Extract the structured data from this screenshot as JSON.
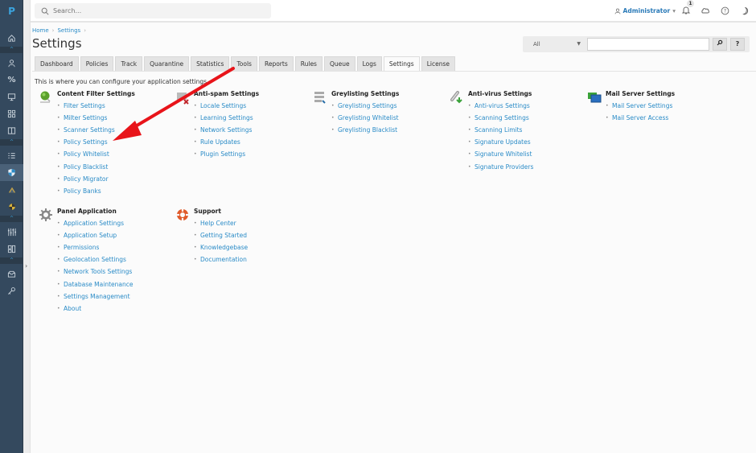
{
  "app": {
    "logo_letter": "P"
  },
  "topbar": {
    "search_placeholder": "Search...",
    "user_label": "Administrator",
    "notification_count": "1"
  },
  "breadcrumb": [
    {
      "label": "Home"
    },
    {
      "label": "Settings"
    }
  ],
  "page": {
    "title": "Settings",
    "intro": "This is where you can configure your application settings."
  },
  "filter": {
    "select_value": "All",
    "input_value": "",
    "search_button": "⌕",
    "help_button": "?"
  },
  "tabs": [
    {
      "label": "Dashboard",
      "active": false
    },
    {
      "label": "Policies",
      "active": false
    },
    {
      "label": "Track",
      "active": false
    },
    {
      "label": "Quarantine",
      "active": false
    },
    {
      "label": "Statistics",
      "active": false
    },
    {
      "label": "Tools",
      "active": false
    },
    {
      "label": "Reports",
      "active": false
    },
    {
      "label": "Rules",
      "active": false
    },
    {
      "label": "Queue",
      "active": false
    },
    {
      "label": "Logs",
      "active": false
    },
    {
      "label": "Settings",
      "active": true
    },
    {
      "label": "License",
      "active": false
    }
  ],
  "sidebar": {
    "items": [
      {
        "icon": "home-icon"
      },
      {
        "icon": "user-icon"
      },
      {
        "icon": "percent-icon"
      },
      {
        "icon": "monitor-icon"
      },
      {
        "icon": "grid-icon"
      },
      {
        "icon": "book-icon"
      },
      {
        "icon": "checklist-icon"
      },
      {
        "icon": "shield-icon",
        "active": true
      },
      {
        "icon": "warning-icon"
      },
      {
        "icon": "hazard-icon"
      },
      {
        "icon": "sliders-icon"
      },
      {
        "icon": "dashboard-icon"
      },
      {
        "icon": "inbox-icon"
      },
      {
        "icon": "key-icon"
      }
    ]
  },
  "groups": {
    "content_filter": {
      "title": "Content Filter Settings",
      "links": [
        "Filter Settings",
        "Milter Settings",
        "Scanner Settings",
        "Policy Settings",
        "Policy Whitelist",
        "Policy Blacklist",
        "Policy Migrator",
        "Policy Banks"
      ]
    },
    "anti_spam": {
      "title": "Anti-spam Settings",
      "links": [
        "Locale Settings",
        "Learning Settings",
        "Network Settings",
        "Rule Updates",
        "Plugin Settings"
      ]
    },
    "greylisting": {
      "title": "Greylisting Settings",
      "links": [
        "Greylisting Settings",
        "Greylisting Whitelist",
        "Greylisting Blacklist"
      ]
    },
    "anti_virus": {
      "title": "Anti-virus Settings",
      "links": [
        "Anti-virus Settings",
        "Scanning Settings",
        "Scanning Limits",
        "Signature Updates",
        "Signature Whitelist",
        "Signature Providers"
      ]
    },
    "mail_server": {
      "title": "Mail Server Settings",
      "links": [
        "Mail Server Settings",
        "Mail Server Access"
      ]
    },
    "panel_application": {
      "title": "Panel Application",
      "links": [
        "Application Settings",
        "Application Setup",
        "Permissions",
        "Geolocation Settings",
        "Network Tools Settings",
        "Database Maintenance",
        "Settings Management",
        "About"
      ]
    },
    "support": {
      "title": "Support",
      "links": [
        "Help Center",
        "Getting Started",
        "Knowledgebase",
        "Documentation"
      ]
    }
  },
  "annotation": {
    "arrow_color": "#e8141a",
    "points_to": "Policy Settings"
  }
}
